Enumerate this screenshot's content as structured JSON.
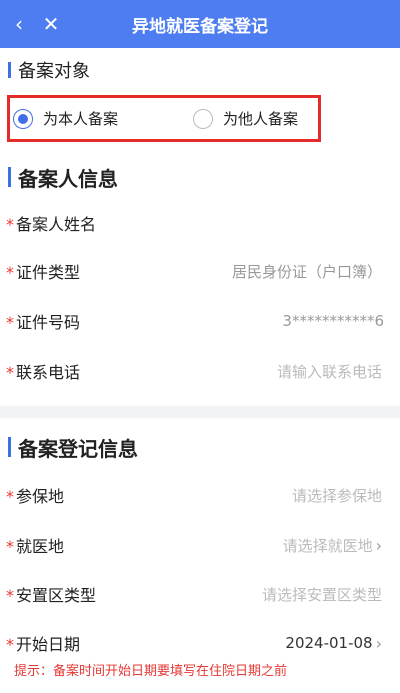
{
  "header": {
    "back_icon": "chevron-left-icon",
    "close_icon": "close-icon",
    "title": "异地就医备案登记"
  },
  "section_target": {
    "title": "备案对象",
    "options": [
      {
        "label": "为本人备案",
        "checked": true
      },
      {
        "label": "为他人备案",
        "checked": false
      }
    ]
  },
  "section_person": {
    "title": "备案人信息",
    "rows": [
      {
        "label": "备案人姓名",
        "value": "",
        "required": true
      },
      {
        "label": "证件类型",
        "value": "居民身份证（户口簿）",
        "required": true
      },
      {
        "label": "证件号码",
        "value": "3***********6",
        "required": true
      },
      {
        "label": "联系电话",
        "placeholder": "请输入联系电话",
        "required": true
      }
    ]
  },
  "section_register": {
    "title": "备案登记信息",
    "rows": [
      {
        "label": "参保地",
        "placeholder": "请选择参保地",
        "required": true
      },
      {
        "label": "就医地",
        "placeholder": "请选择就医地",
        "required": true
      },
      {
        "label": "安置区类型",
        "placeholder": "请选择安置区类型",
        "required": true
      },
      {
        "label": "开始日期",
        "value": "2024-01-08",
        "required": true
      }
    ],
    "hint": "提示：备案时间开始日期要填写在住院日期之前"
  },
  "required_mark": "*",
  "colors": {
    "header_bg": "#4d7df0",
    "accent": "#3f6fe8",
    "required": "#e53935",
    "highlight_box": "#e52a2a"
  }
}
